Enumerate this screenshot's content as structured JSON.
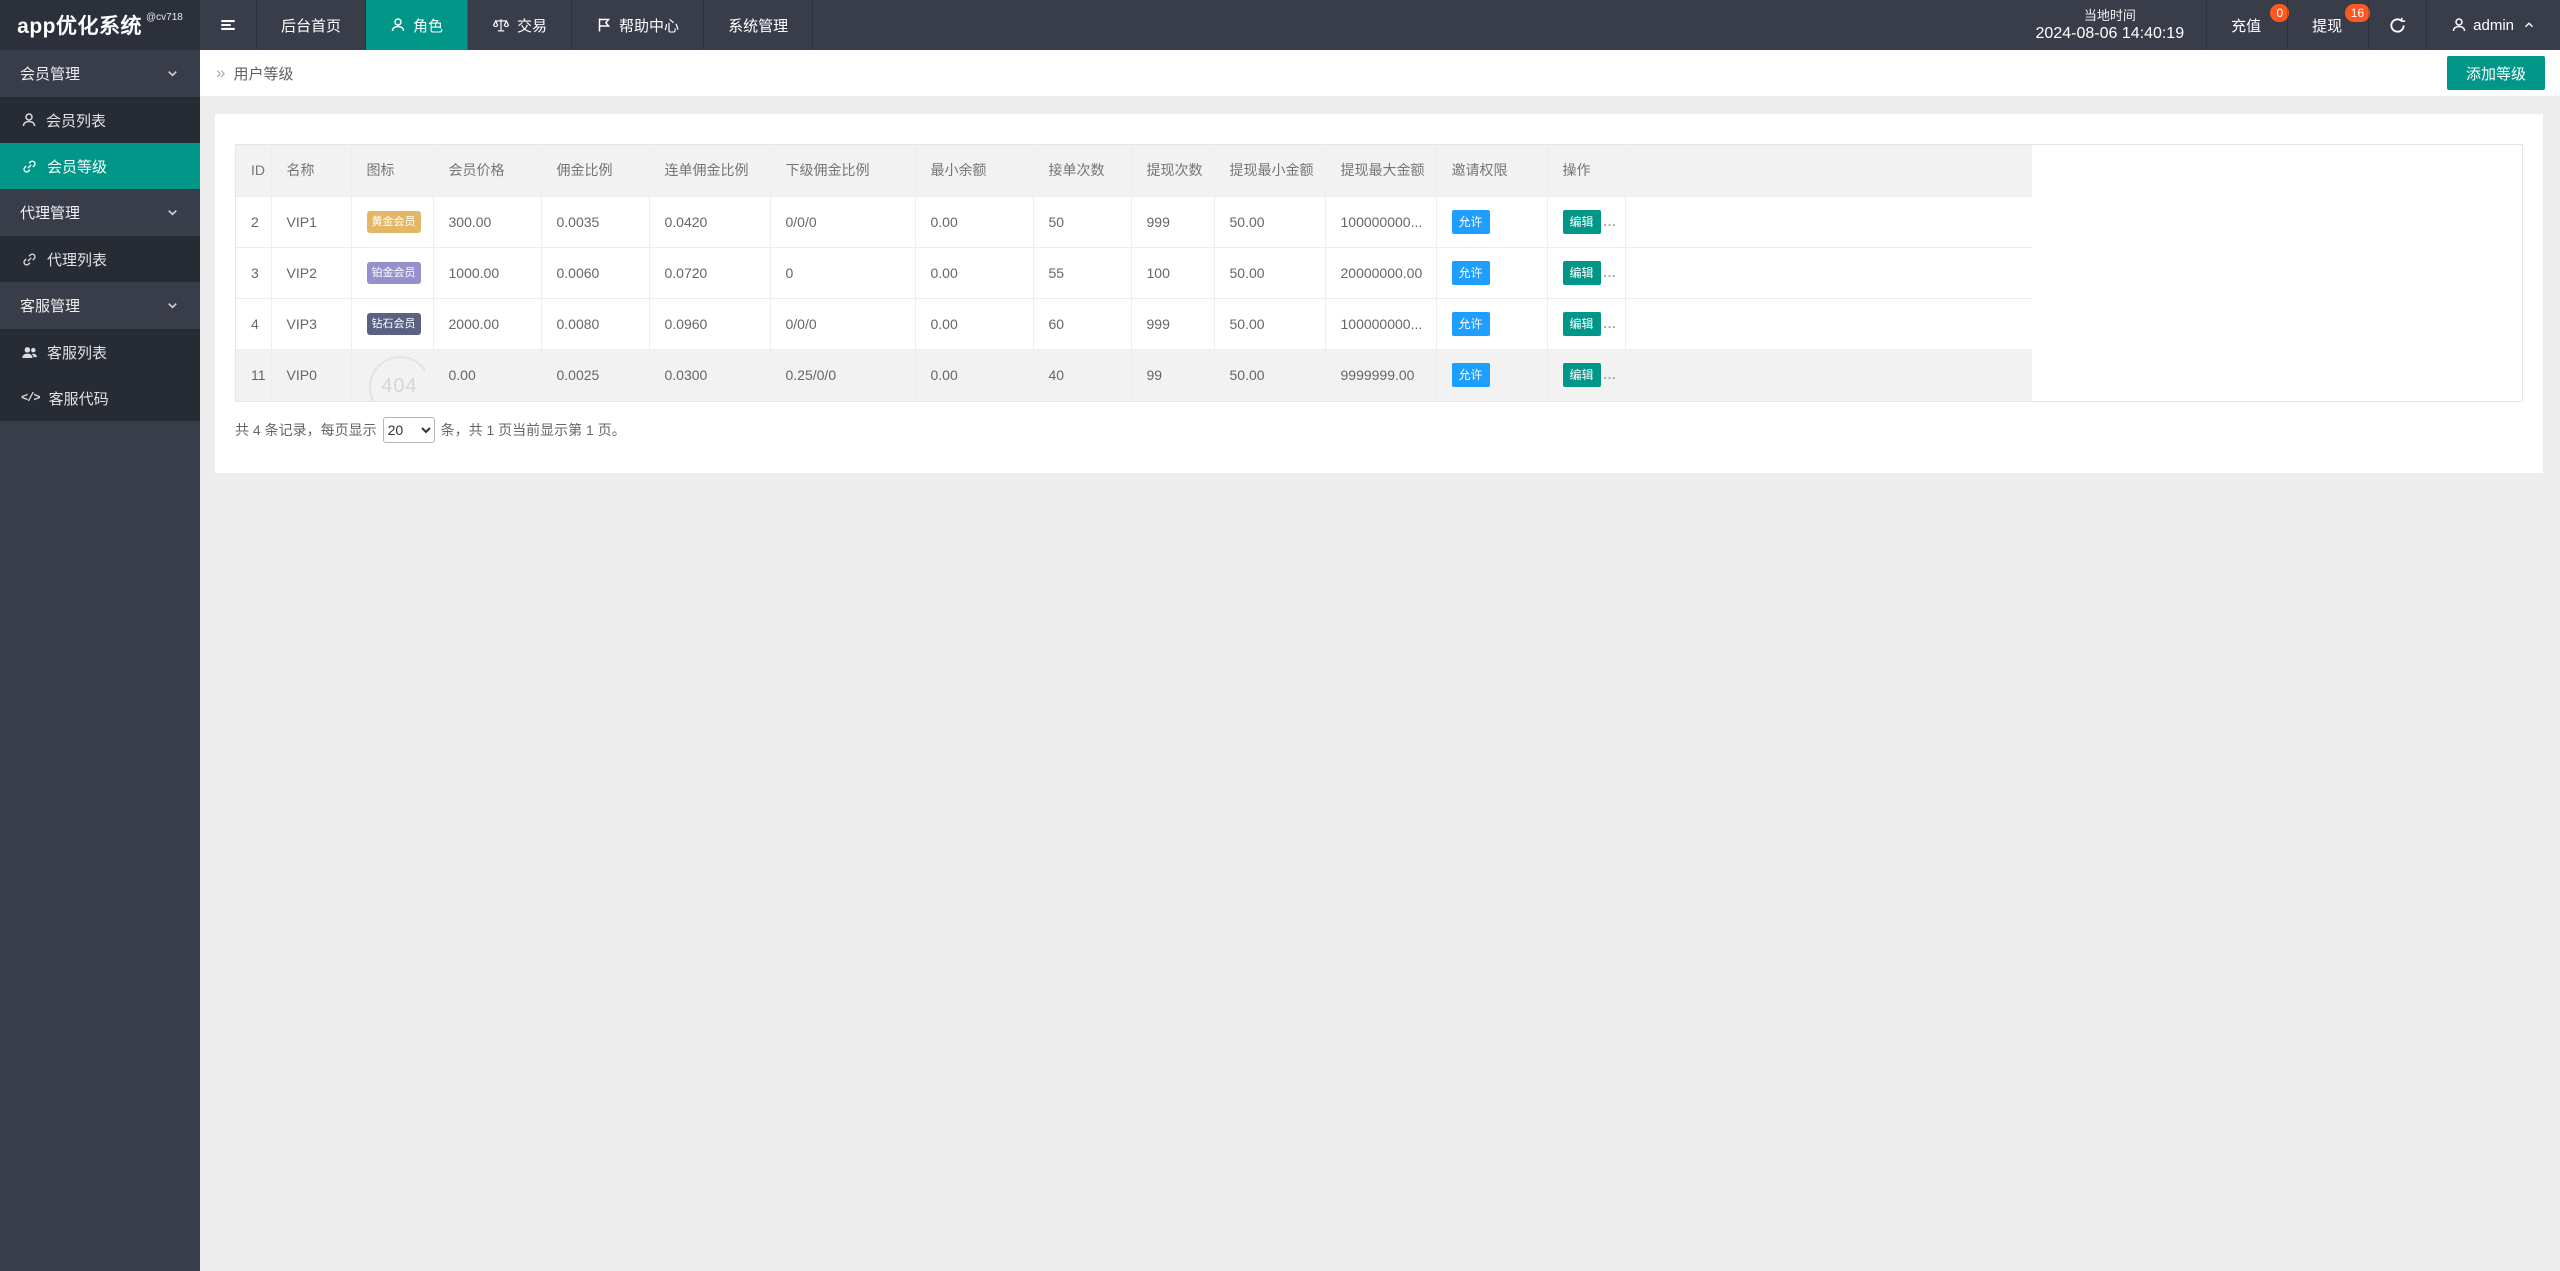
{
  "colors": {
    "accent": "#009688",
    "blue": "#1E9FFF",
    "badge": "#ff5722",
    "gold": "#e3b766",
    "purple": "#9690cd",
    "slate": "#5a6183"
  },
  "header": {
    "logo_title": "app优化系统",
    "logo_sub": "@cv718",
    "nav": [
      {
        "label": "后台首页"
      },
      {
        "label": "角色"
      },
      {
        "label": "交易"
      },
      {
        "label": "帮助中心"
      },
      {
        "label": "系统管理"
      }
    ],
    "time_label": "当地时间",
    "time_value": "2024-08-06 14:40:19",
    "recharge_label": "充值",
    "recharge_badge": "0",
    "withdraw_label": "提现",
    "withdraw_badge": "16",
    "username": "admin"
  },
  "sidebar": {
    "group_member": "会员管理",
    "item_member_list": "会员列表",
    "item_member_level": "会员等级",
    "group_agent": "代理管理",
    "item_agent_list": "代理列表",
    "group_service": "客服管理",
    "item_service_list": "客服列表",
    "item_service_code": "客服代码"
  },
  "breadcrumb": {
    "label": "用户等级"
  },
  "toolbar": {
    "add_label": "添加等级"
  },
  "table": {
    "headers": {
      "id": "ID",
      "name": "名称",
      "icon": "图标",
      "price": "会员价格",
      "rate": "佣金比例",
      "chain_rate": "连单佣金比例",
      "sub_rate": "下级佣金比例",
      "min_balance": "最小余额",
      "order_count": "接单次数",
      "wd_count": "提现次数",
      "wd_min": "提现最小金额",
      "wd_max": "提现最大金额",
      "invite": "邀请权限",
      "action": "操作"
    },
    "invite_label": "允许",
    "edit_label": "编辑",
    "more_label": "...",
    "rows": [
      {
        "id": "2",
        "name": "VIP1",
        "badge": "黄金会员",
        "price": "300.00",
        "rate": "0.0035",
        "chain_rate": "0.0420",
        "sub_rate": "0/0/0",
        "min_balance": "0.00",
        "order_count": "50",
        "wd_count": "999",
        "wd_min": "50.00",
        "wd_max": "100000000..."
      },
      {
        "id": "3",
        "name": "VIP2",
        "badge": "铂金会员",
        "price": "1000.00",
        "rate": "0.0060",
        "chain_rate": "0.0720",
        "sub_rate": "0",
        "min_balance": "0.00",
        "order_count": "55",
        "wd_count": "100",
        "wd_min": "50.00",
        "wd_max": "20000000.00"
      },
      {
        "id": "4",
        "name": "VIP3",
        "badge": "钻石会员",
        "price": "2000.00",
        "rate": "0.0080",
        "chain_rate": "0.0960",
        "sub_rate": "0/0/0",
        "min_balance": "0.00",
        "order_count": "60",
        "wd_count": "999",
        "wd_min": "50.00",
        "wd_max": "100000000..."
      },
      {
        "id": "11",
        "name": "VIP0",
        "icon_placeholder": "404",
        "price": "0.00",
        "rate": "0.0025",
        "chain_rate": "0.0300",
        "sub_rate": "0.25/0/0",
        "min_balance": "0.00",
        "order_count": "40",
        "wd_count": "99",
        "wd_min": "50.00",
        "wd_max": "9999999.00"
      }
    ]
  },
  "pagination": {
    "prefix": "共 4 条记录，每页显示",
    "page_size": "20",
    "suffix": "条，共 1 页当前显示第 1 页。"
  }
}
